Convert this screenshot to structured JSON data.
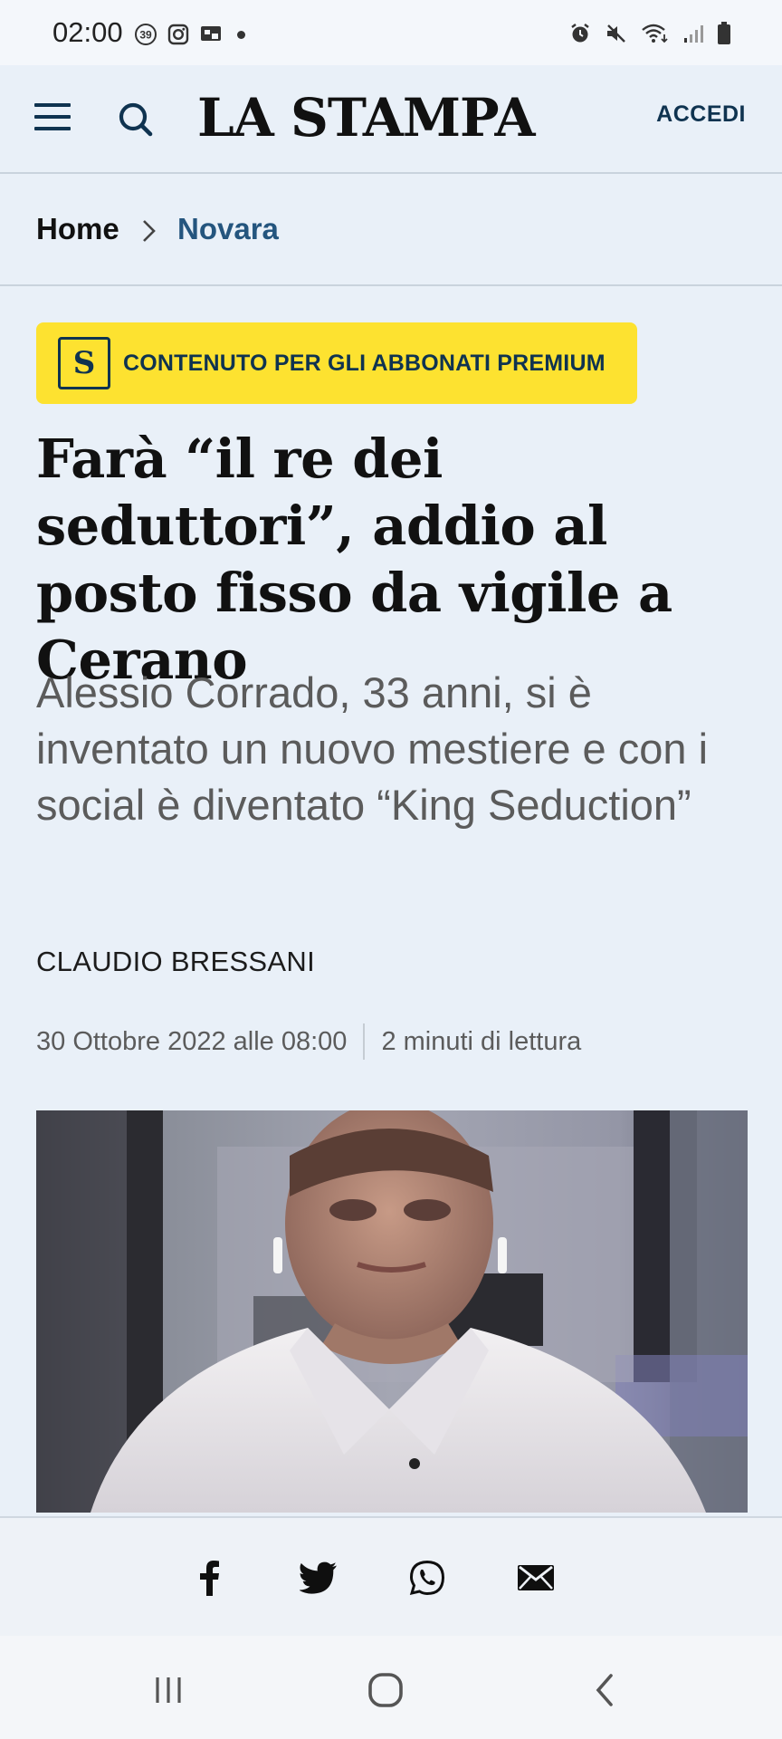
{
  "status_bar": {
    "time": "02:00",
    "notification_icons": [
      "notification-count-icon",
      "instagram-icon",
      "screen-cast-icon"
    ],
    "notification_count": "39",
    "system_icons": [
      "alarm-icon",
      "mute-icon",
      "wifi-icon",
      "signal-icon",
      "battery-icon"
    ]
  },
  "header": {
    "logo": "LA STAMPA",
    "login_label": "ACCEDI"
  },
  "breadcrumb": {
    "home": "Home",
    "category": "Novara"
  },
  "premium_badge": {
    "icon_letter": "S",
    "label": "CONTENUTO PER GLI ABBONATI PREMIUM",
    "color": "#fde230"
  },
  "article": {
    "title": "Farà “il re dei seduttori”, addio al posto fisso da vigile a Cerano",
    "subtitle": "Alessio Corrado, 33 anni, si è inventato un nuovo mestiere e con i social è diventato “King Seduction”",
    "author": "CLAUDIO BRESSANI",
    "date": "30 Ottobre 2022 alle 08:00",
    "reading_time": "2 minuti di lettura"
  },
  "share": [
    "facebook-icon",
    "twitter-icon",
    "whatsapp-icon",
    "email-icon"
  ],
  "navigation": [
    "recent-apps-icon",
    "home-icon",
    "back-icon"
  ],
  "colors": {
    "background": "#e9f0f8",
    "accent_blue": "#24557e",
    "dark_navy": "#0f3350"
  }
}
